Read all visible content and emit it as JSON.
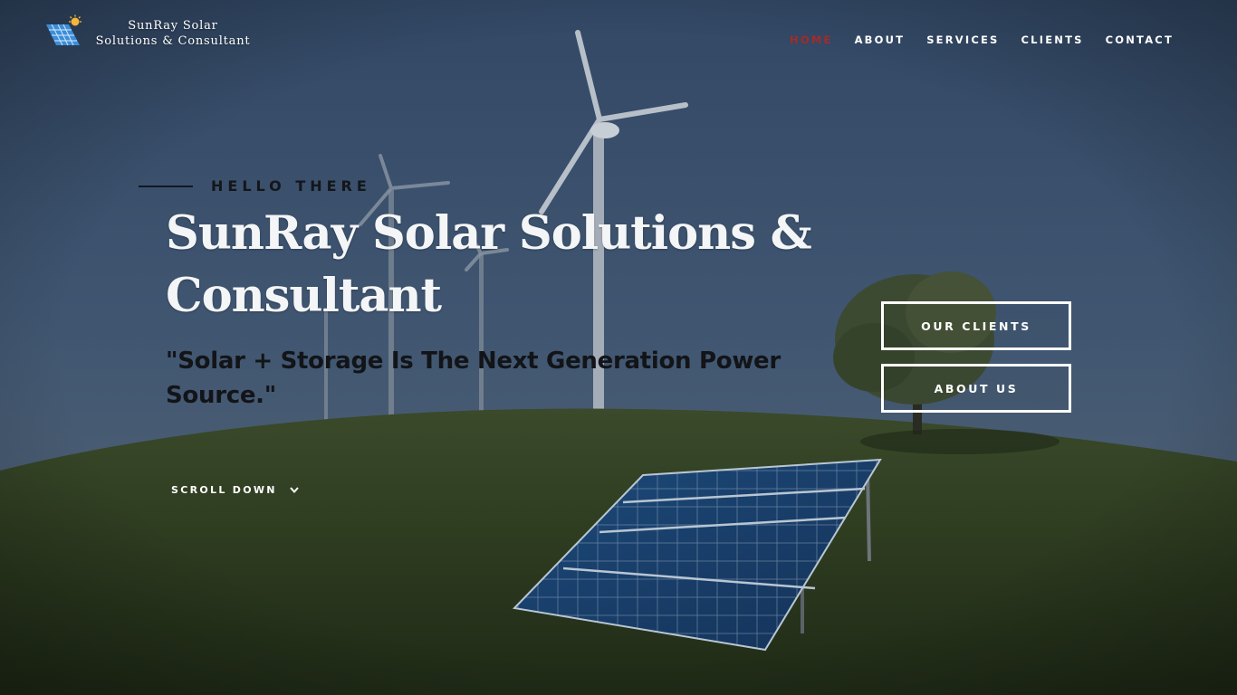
{
  "brand": {
    "line1": "SunRay Solar",
    "line2": "Solutions & Consultant",
    "logo_icon": "solar-panel-sun-icon"
  },
  "nav": {
    "items": [
      {
        "label": "HOME",
        "active": true
      },
      {
        "label": "ABOUT",
        "active": false
      },
      {
        "label": "SERVICES",
        "active": false
      },
      {
        "label": "CLIENTS",
        "active": false
      },
      {
        "label": "CONTACT",
        "active": false
      }
    ],
    "active_color": "#a52a2a"
  },
  "hero": {
    "kicker": "HELLO THERE",
    "title": "SunRay Solar Solutions & Consultant",
    "quote": "\"Solar + Storage Is The Next Generation Power Source.\"",
    "scroll_label": "SCROLL DOWN",
    "scroll_icon": "chevron-down-icon",
    "background": "wind-turbines-and-solar-panel-on-grass-hill"
  },
  "cta": {
    "clients_label": "OUR CLIENTS",
    "about_label": "ABOUT US"
  },
  "colors": {
    "sky": "#3d5270",
    "grass": "#2e3b22",
    "title_text": "#f4f5f7",
    "dark_text": "#14161a"
  }
}
